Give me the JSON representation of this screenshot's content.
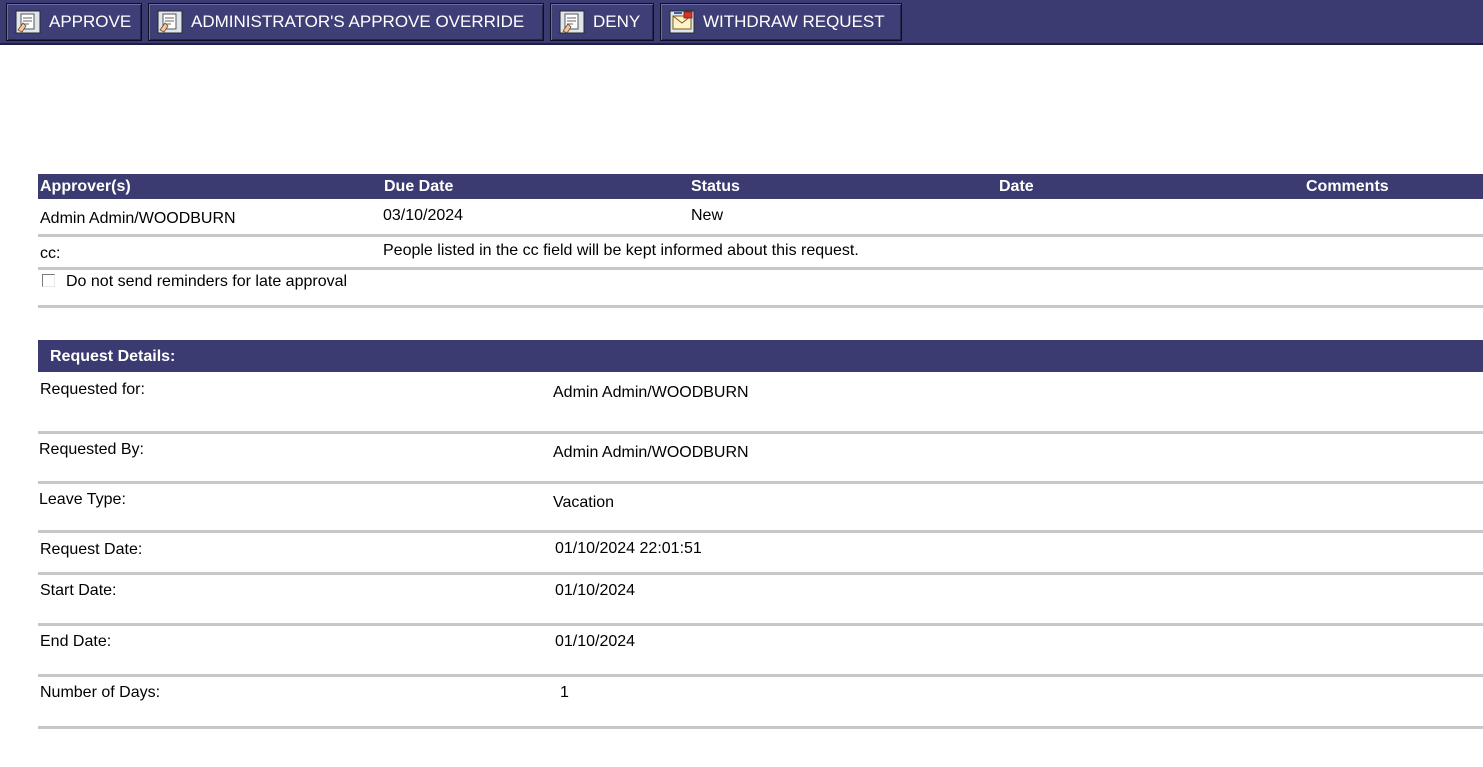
{
  "toolbar": {
    "approve": "APPROVE",
    "override": "ADMINISTRATOR'S APPROVE OVERRIDE",
    "deny": "DENY",
    "withdraw": "WITHDRAW REQUEST"
  },
  "approvers": {
    "headers": {
      "approver": "Approver(s)",
      "due_date": "Due Date",
      "status": "Status",
      "date": "Date",
      "comments": "Comments"
    },
    "row": {
      "approver": "Admin Admin/WOODBURN",
      "due_date": "03/10/2024",
      "status": "New"
    },
    "cc_label": "cc:",
    "cc_note": "People listed in the cc field will be kept informed about this request.",
    "reminder_label": "Do not send reminders for late approval",
    "reminder_checked": false
  },
  "details": {
    "title": "Request Details:",
    "rows": [
      {
        "label": "Requested for:",
        "value": "Admin Admin/WOODBURN"
      },
      {
        "label": "Requested By:",
        "value": "Admin Admin/WOODBURN"
      },
      {
        "label": "Leave Type:",
        "value": "Vacation"
      },
      {
        "label": "Request Date:",
        "value": "01/10/2024 22:01:51"
      },
      {
        "label": "Start Date:",
        "value": "01/10/2024"
      },
      {
        "label": "End Date:",
        "value": "01/10/2024"
      },
      {
        "label": "Number of Days:",
        "value": "1"
      }
    ]
  },
  "colors": {
    "header_bg": "#3b3b72",
    "divider": "#c8c8c8"
  },
  "icons": {
    "approve": "document-hand-icon",
    "override": "document-hand-icon",
    "deny": "document-deny-icon",
    "withdraw": "envelope-withdraw-icon"
  }
}
